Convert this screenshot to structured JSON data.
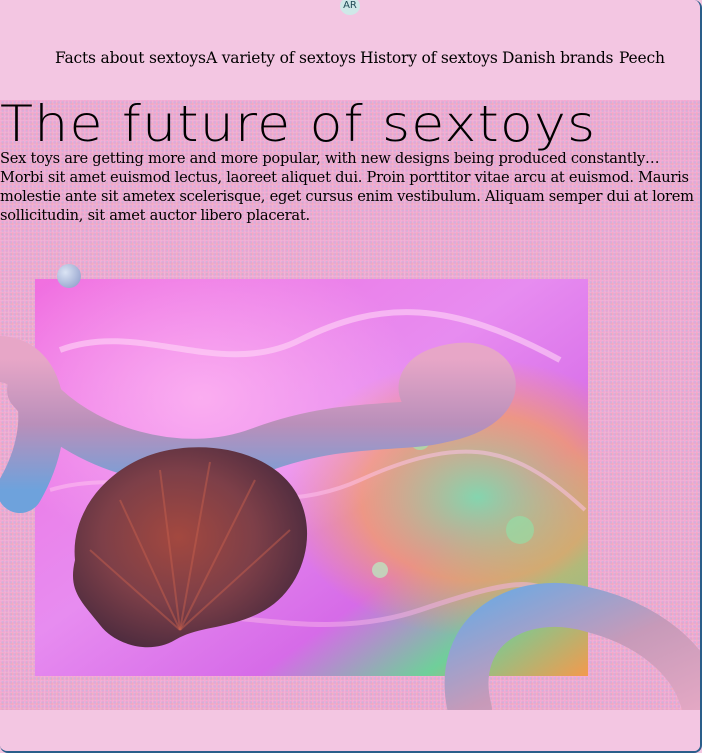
{
  "badge": {
    "label": "AR"
  },
  "nav": {
    "items": [
      {
        "label": "Facts about sextoys"
      },
      {
        "label": "A variety of sextoys"
      },
      {
        "label": "History of sextoys"
      },
      {
        "label": "Danish brands"
      },
      {
        "label": "Peech"
      }
    ]
  },
  "hero": {
    "title": "The future of sextoys",
    "intro": "Sex toys are getting more and more popular, with new designs being produced constantly… Morbi sit amet euismod lectus, laoreet aliquet dui. Proin porttitor vitae arcu at euismod. Mauris molestie ante sit ametex scelerisque, eget cursus enim vestibulum. Aliquam semper dui at lorem sollicitudin, sit amet auctor libero placerat."
  },
  "colors": {
    "header_bg": "#f3c6e2",
    "main_bg": "#f0b3d6",
    "frame_border": "#2a5e8a"
  }
}
